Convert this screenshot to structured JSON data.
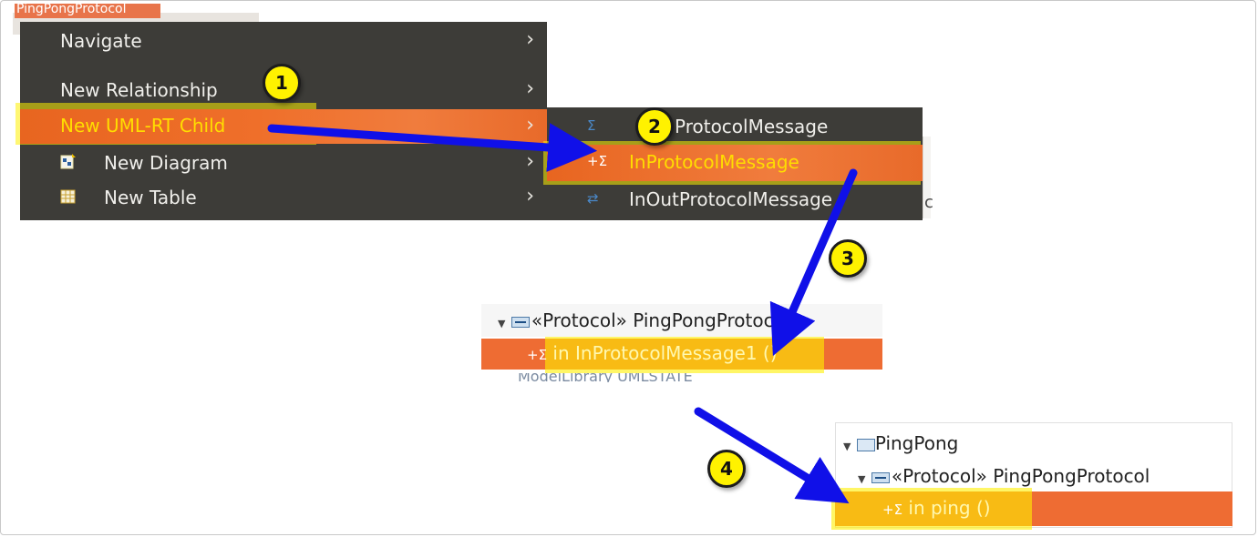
{
  "context_menu": {
    "partial_header": "PingPongProtocol",
    "items": [
      {
        "label": "Navigate",
        "has_submenu": true
      },
      {
        "label": "New Relationship",
        "has_submenu": true
      },
      {
        "label": "New UML-RT Child",
        "has_submenu": true,
        "active": true
      },
      {
        "label": "New Diagram",
        "has_submenu": true,
        "icon": "new-diagram-icon"
      },
      {
        "label": "New Table",
        "has_submenu": true,
        "icon": "new-table-icon"
      }
    ],
    "arrow_glyph": "›"
  },
  "submenu": {
    "items": [
      {
        "label": "ProtocolMessage",
        "icon": "out-message-icon"
      },
      {
        "label": "InProtocolMessage",
        "icon": "in-message-icon",
        "active": true
      },
      {
        "label": "InOutProtocolMessage",
        "icon": "inout-message-icon"
      }
    ],
    "side_fragment": "c"
  },
  "tree_before": {
    "protocol_label": "«Protocol» PingPongProtocol",
    "message_label": "in InProtocolMessage1 ()",
    "cut_label": "ModelLibrary UMLSTATE"
  },
  "tree_after": {
    "package_label": "PingPong",
    "protocol_label": "«Protocol» PingPongProtocol",
    "message_label": "in ping ()"
  },
  "steps": [
    "1",
    "2",
    "3",
    "4"
  ],
  "colors": {
    "menu_bg": "#3d3c38",
    "selection_orange": "#ee6c33",
    "highlight_yellow": "#fff200",
    "arrow_blue": "#1010e8"
  }
}
